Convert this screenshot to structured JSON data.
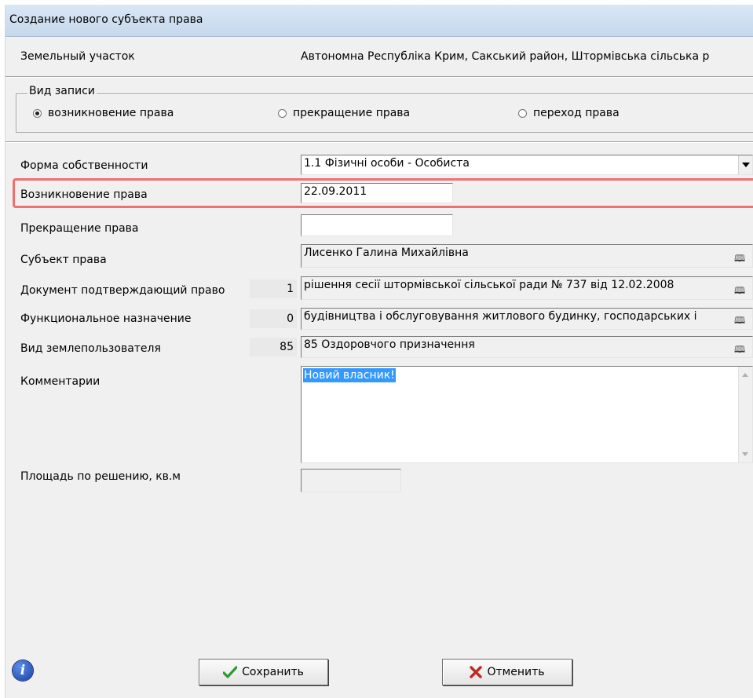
{
  "window": {
    "title": "Создание нового субъекта права"
  },
  "land_plot": {
    "label": "Земельный участок",
    "value": "Автономна Республіка Крим, Сакський район, Штормівська сільська р"
  },
  "record_type": {
    "legend": "Вид записи",
    "options": [
      {
        "label": "возникновение права",
        "checked": true
      },
      {
        "label": "прекращение права",
        "checked": false
      },
      {
        "label": "переход права",
        "checked": false
      }
    ]
  },
  "form": {
    "ownership_form": {
      "label": "Форма собственности",
      "value": "1.1 Фізичні особи - Особиста"
    },
    "right_start": {
      "label": "Возникновение права",
      "value": "22.09.2011"
    },
    "right_end": {
      "label": "Прекращение права",
      "value": ""
    },
    "subject": {
      "label": "Субъект права",
      "value": "Лисенко Галина Михайлівна"
    },
    "document": {
      "label": "Документ подтверждающий право",
      "code": "1",
      "value": "рішення сесії штормівської сільської ради № 737 від 12.02.2008"
    },
    "purpose": {
      "label": "Функциональное назначение",
      "code": "0",
      "value": "будівництва і обслуговування житлового будинку, господарських і"
    },
    "user_type": {
      "label": "Вид землепользователя",
      "code": "85",
      "value": "85 Оздоровчого призначення"
    },
    "comments": {
      "label": "Комментарии",
      "value": "Новий власник!"
    },
    "area": {
      "label": "Площадь по решению, кв.м",
      "value": ""
    }
  },
  "buttons": {
    "save": "Сохранить",
    "cancel": "Отменить"
  },
  "colors": {
    "highlight": "#f07070",
    "selection": "#3399ff",
    "save_check": "#2e9a2e",
    "cancel_x": "#c0281c"
  }
}
